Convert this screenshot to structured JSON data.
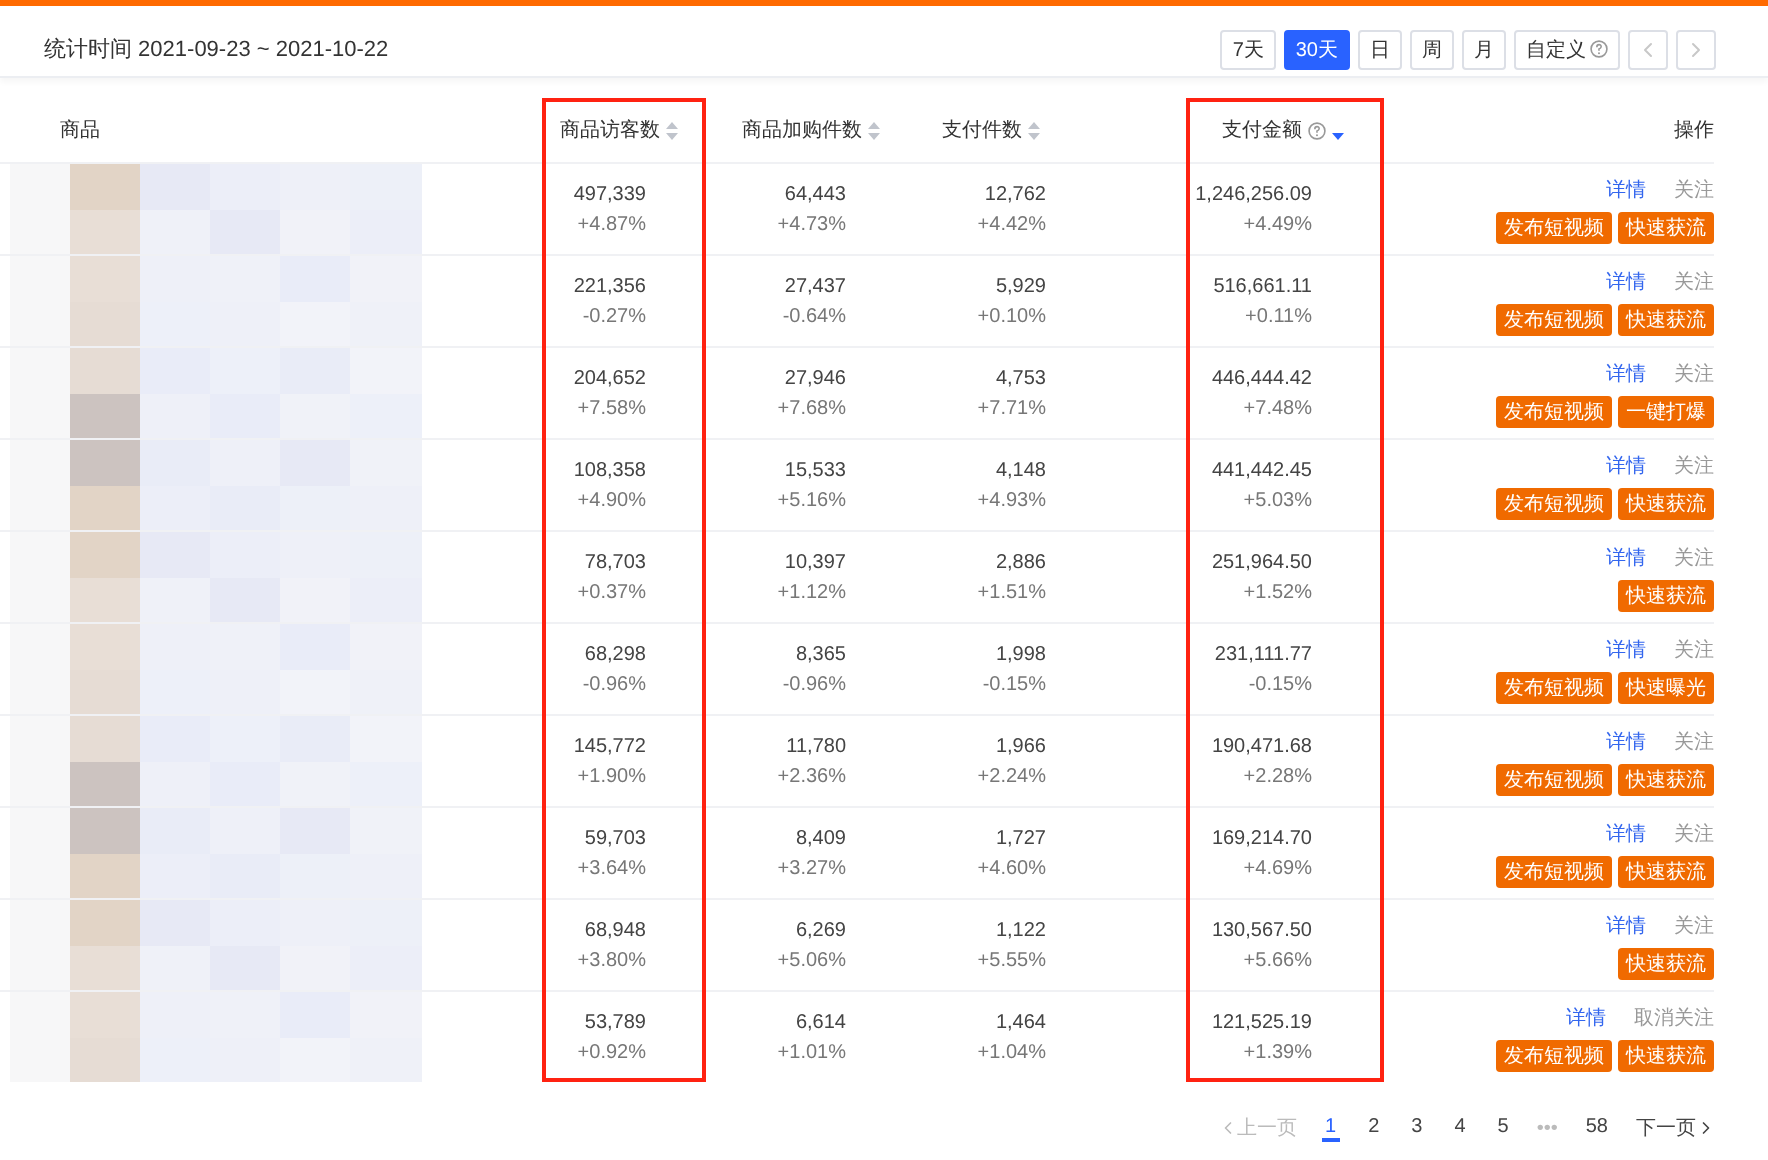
{
  "header": {
    "date_range": "统计时间 2021-09-23 ~ 2021-10-22",
    "ranges": [
      {
        "label": "7天",
        "selected": false,
        "kind": "plain"
      },
      {
        "label": "30天",
        "selected": true,
        "kind": "plain"
      },
      {
        "label": "日",
        "selected": false,
        "kind": "plain"
      },
      {
        "label": "周",
        "selected": false,
        "kind": "plain"
      },
      {
        "label": "月",
        "selected": false,
        "kind": "plain"
      },
      {
        "label": "自定义",
        "selected": false,
        "kind": "info"
      }
    ],
    "nav": {
      "prev_disabled": true,
      "next_disabled": true
    }
  },
  "table": {
    "columns": [
      {
        "label": "商品",
        "kind": "product",
        "sortable": false,
        "highlighted": false
      },
      {
        "label": "商品访客数",
        "kind": "metric",
        "sortable": true,
        "sorted_desc": false,
        "highlighted": true
      },
      {
        "label": "商品加购件数",
        "kind": "metric",
        "sortable": true,
        "sorted_desc": false,
        "highlighted": false
      },
      {
        "label": "支付件数",
        "kind": "metric",
        "sortable": true,
        "sorted_desc": false,
        "highlighted": false
      },
      {
        "label": "支付金额",
        "kind": "metric",
        "sortable": true,
        "sorted_desc": true,
        "info": true,
        "highlighted": true
      },
      {
        "label": "操作",
        "kind": "actions",
        "sortable": false,
        "highlighted": false
      }
    ],
    "rows": [
      {
        "metrics": [
          [
            "497,339",
            "+4.87%"
          ],
          [
            "64,443",
            "+4.73%"
          ],
          [
            "12,762",
            "+4.42%"
          ],
          [
            "1,246,256.09",
            "+4.49%"
          ]
        ],
        "links": [
          "详情",
          "关注"
        ],
        "buttons": [
          "发布短视频",
          "快速获流"
        ]
      },
      {
        "metrics": [
          [
            "221,356",
            "-0.27%"
          ],
          [
            "27,437",
            "-0.64%"
          ],
          [
            "5,929",
            "+0.10%"
          ],
          [
            "516,661.11",
            "+0.11%"
          ]
        ],
        "links": [
          "详情",
          "关注"
        ],
        "buttons": [
          "发布短视频",
          "快速获流"
        ]
      },
      {
        "metrics": [
          [
            "204,652",
            "+7.58%"
          ],
          [
            "27,946",
            "+7.68%"
          ],
          [
            "4,753",
            "+7.71%"
          ],
          [
            "446,444.42",
            "+7.48%"
          ]
        ],
        "links": [
          "详情",
          "关注"
        ],
        "buttons": [
          "发布短视频",
          "一键打爆"
        ]
      },
      {
        "metrics": [
          [
            "108,358",
            "+4.90%"
          ],
          [
            "15,533",
            "+5.16%"
          ],
          [
            "4,148",
            "+4.93%"
          ],
          [
            "441,442.45",
            "+5.03%"
          ]
        ],
        "links": [
          "详情",
          "关注"
        ],
        "buttons": [
          "发布短视频",
          "快速获流"
        ]
      },
      {
        "metrics": [
          [
            "78,703",
            "+0.37%"
          ],
          [
            "10,397",
            "+1.12%"
          ],
          [
            "2,886",
            "+1.51%"
          ],
          [
            "251,964.50",
            "+1.52%"
          ]
        ],
        "links": [
          "详情",
          "关注"
        ],
        "buttons": [
          "快速获流"
        ]
      },
      {
        "metrics": [
          [
            "68,298",
            "-0.96%"
          ],
          [
            "8,365",
            "-0.96%"
          ],
          [
            "1,998",
            "-0.15%"
          ],
          [
            "231,111.77",
            "-0.15%"
          ]
        ],
        "links": [
          "详情",
          "关注"
        ],
        "buttons": [
          "发布短视频",
          "快速曝光"
        ]
      },
      {
        "metrics": [
          [
            "145,772",
            "+1.90%"
          ],
          [
            "11,780",
            "+2.36%"
          ],
          [
            "1,966",
            "+2.24%"
          ],
          [
            "190,471.68",
            "+2.28%"
          ]
        ],
        "links": [
          "详情",
          "关注"
        ],
        "buttons": [
          "发布短视频",
          "快速获流"
        ]
      },
      {
        "metrics": [
          [
            "59,703",
            "+3.64%"
          ],
          [
            "8,409",
            "+3.27%"
          ],
          [
            "1,727",
            "+4.60%"
          ],
          [
            "169,214.70",
            "+4.69%"
          ]
        ],
        "links": [
          "详情",
          "关注"
        ],
        "buttons": [
          "发布短视频",
          "快速获流"
        ]
      },
      {
        "metrics": [
          [
            "68,948",
            "+3.80%"
          ],
          [
            "6,269",
            "+5.06%"
          ],
          [
            "1,122",
            "+5.55%"
          ],
          [
            "130,567.50",
            "+5.66%"
          ]
        ],
        "links": [
          "详情",
          "关注"
        ],
        "buttons": [
          "快速获流"
        ]
      },
      {
        "metrics": [
          [
            "53,789",
            "+0.92%"
          ],
          [
            "6,614",
            "+1.01%"
          ],
          [
            "1,464",
            "+1.04%"
          ],
          [
            "121,525.19",
            "+1.39%"
          ]
        ],
        "links": [
          "详情",
          "取消关注"
        ],
        "buttons": [
          "发布短视频",
          "快速获流"
        ]
      }
    ]
  },
  "pagination": {
    "prev": {
      "label": "上一页",
      "disabled": true
    },
    "pages": [
      {
        "label": "1",
        "selected": true
      },
      {
        "label": "2",
        "selected": false
      },
      {
        "label": "3",
        "selected": false
      },
      {
        "label": "4",
        "selected": false
      },
      {
        "label": "5",
        "selected": false
      }
    ],
    "ellipsis": "•••",
    "last": {
      "label": "58",
      "selected": false
    },
    "next": {
      "label": "下一页",
      "disabled": false
    }
  }
}
